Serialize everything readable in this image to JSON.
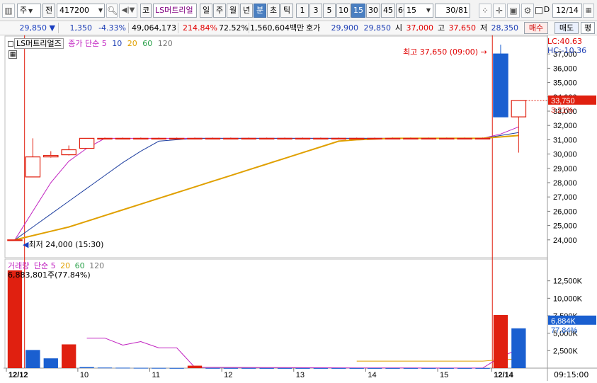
{
  "toolbar": {
    "market": "주",
    "prefix": "전",
    "code": "417200",
    "stock_badge": "코",
    "stock_name": "LS머트리얼",
    "periods": [
      "일",
      "주",
      "월",
      "년",
      "분",
      "초",
      "틱"
    ],
    "selected_period": "분",
    "intervals": [
      "1",
      "3",
      "5",
      "10",
      "15",
      "30",
      "45",
      "60"
    ],
    "selected_interval": "15",
    "interval_select": "15",
    "page_current": "30",
    "page_total": "/81",
    "d_label": "D",
    "date_input": "12/14"
  },
  "quote": {
    "price": "29,850",
    "direction": "▼",
    "change": "1,350",
    "change_pct": "-4.33%",
    "volume": "49,064,173",
    "volume_ratio": "214.84%",
    "turnover_ratio": "72.52%",
    "amount": "1,560,604백만",
    "hoga_label": "호가",
    "ask": "29,900",
    "bid": "29,850",
    "open_label": "시",
    "open": "37,000",
    "high_label": "고",
    "high": "37,650",
    "low_label": "저",
    "low": "28,350",
    "buy_button": "매수",
    "sell_button": "매도",
    "eval_button": "평"
  },
  "price_panel": {
    "stock_tag": "LS머트리얼즈",
    "ma_label": "종가 단순",
    "ma_periods": [
      "5",
      "10",
      "20",
      "60",
      "120"
    ],
    "lc": "LC:40.63",
    "hc": "HC:-10.36",
    "high_annot": "최고 37,650 (09:00)",
    "low_annot": "최저 24,000 (15:30)",
    "last_price": "33,750",
    "last_pct": "3.21%",
    "y_ticks": [
      "37,000",
      "36,000",
      "35,000",
      "34,000",
      "33,000",
      "32,000",
      "31,000",
      "30,000",
      "29,000",
      "28,000",
      "27,000",
      "26,000",
      "25,000",
      "24,000"
    ]
  },
  "volume_panel": {
    "label": "거래량",
    "ma_label": "단순",
    "ma_periods": [
      "5",
      "20",
      "60",
      "120"
    ],
    "value_text": "6,883,801주(77.84%)",
    "last_value": "6,884K",
    "last_pct": "77.84%",
    "y_ticks": [
      "12,500K",
      "10,000K",
      "7,500K",
      "5,000K",
      "2,500K"
    ]
  },
  "x_axis": {
    "labels": [
      "12/12",
      "10",
      "11",
      "12",
      "13",
      "14",
      "15",
      "12/14"
    ],
    "time": "09:15:00"
  },
  "colors": {
    "up": "#e02010",
    "down": "#1a5fd0",
    "ma5": "#c020c0",
    "ma10": "#1e3fa0",
    "ma20": "#e0a000",
    "ma60": "#28a048",
    "ma120": "#777777"
  },
  "chart_data": [
    {
      "type": "candlestick",
      "title": "LS머트리얼즈",
      "ylim": [
        23000,
        38000
      ],
      "candles": [
        {
          "o": 24000,
          "h": 24000,
          "l": 24000,
          "c": 24000
        },
        {
          "o": 28400,
          "h": 31100,
          "l": 28400,
          "c": 29800
        },
        {
          "o": 29800,
          "h": 30200,
          "l": 29750,
          "c": 29900
        },
        {
          "o": 29950,
          "h": 30600,
          "l": 29900,
          "c": 30300
        },
        {
          "o": 30400,
          "h": 31100,
          "l": 30400,
          "c": 31100
        },
        {
          "o": 31100,
          "h": 31150,
          "l": 31050,
          "c": 31100
        },
        {
          "o": 31100,
          "h": 31150,
          "l": 31050,
          "c": 31100
        },
        {
          "o": 31100,
          "h": 31150,
          "l": 31050,
          "c": 31100
        },
        {
          "o": 31100,
          "h": 31150,
          "l": 31050,
          "c": 31100
        },
        {
          "o": 31100,
          "h": 31150,
          "l": 31050,
          "c": 31100
        },
        {
          "o": 31100,
          "h": 31150,
          "l": 31050,
          "c": 31100
        },
        {
          "o": 31100,
          "h": 31150,
          "l": 31050,
          "c": 31100
        },
        {
          "o": 31100,
          "h": 31150,
          "l": 31050,
          "c": 31100
        },
        {
          "o": 31100,
          "h": 31150,
          "l": 31050,
          "c": 31100
        },
        {
          "o": 31100,
          "h": 31150,
          "l": 31050,
          "c": 31100
        },
        {
          "o": 31100,
          "h": 31150,
          "l": 31050,
          "c": 31100
        },
        {
          "o": 31100,
          "h": 31150,
          "l": 31050,
          "c": 31100
        },
        {
          "o": 31100,
          "h": 31150,
          "l": 31050,
          "c": 31100
        },
        {
          "o": 31100,
          "h": 31150,
          "l": 31050,
          "c": 31100
        },
        {
          "o": 31100,
          "h": 31150,
          "l": 31050,
          "c": 31100
        },
        {
          "o": 31100,
          "h": 31150,
          "l": 31050,
          "c": 31100
        },
        {
          "o": 31100,
          "h": 31150,
          "l": 31050,
          "c": 31100
        },
        {
          "o": 31100,
          "h": 31150,
          "l": 31050,
          "c": 31100
        },
        {
          "o": 31100,
          "h": 31150,
          "l": 31050,
          "c": 31100
        },
        {
          "o": 31100,
          "h": 31150,
          "l": 31050,
          "c": 31100
        },
        {
          "o": 31100,
          "h": 31150,
          "l": 31050,
          "c": 31100
        },
        {
          "o": 31100,
          "h": 31150,
          "l": 31050,
          "c": 31100
        },
        {
          "o": 37000,
          "h": 37650,
          "l": 32600,
          "c": 32600
        },
        {
          "o": 32600,
          "h": 33750,
          "l": 30100,
          "c": 33750
        }
      ],
      "ma": [
        {
          "name": "5",
          "values": [
            24000,
            26000,
            28000,
            29500,
            30400,
            31100,
            31100,
            31100,
            31100,
            31100,
            31100,
            31100,
            31100,
            31100,
            31100,
            31100,
            31100,
            31100,
            31100,
            31100,
            31100,
            31100,
            31100,
            31100,
            31100,
            31100,
            31100,
            31400,
            31900
          ]
        },
        {
          "name": "10",
          "values": [
            24000,
            24900,
            25800,
            26700,
            27600,
            28500,
            29400,
            30200,
            30900,
            31000,
            31100,
            31100,
            31100,
            31100,
            31100,
            31100,
            31100,
            31100,
            31100,
            31100,
            31100,
            31100,
            31100,
            31100,
            31100,
            31100,
            31100,
            31300,
            31500
          ]
        },
        {
          "name": "20",
          "values": [
            24000,
            24300,
            24600,
            24900,
            25300,
            25700,
            26100,
            26500,
            26900,
            27300,
            27700,
            28100,
            28500,
            28900,
            29300,
            29700,
            30100,
            30500,
            30900,
            31000,
            31050,
            31100,
            31100,
            31100,
            31100,
            31100,
            31100,
            31200,
            31300
          ]
        }
      ]
    },
    {
      "type": "bar",
      "title": "거래량",
      "ylim": [
        0,
        15000000
      ],
      "values": [
        14000000,
        2600000,
        1400000,
        3400000,
        150000,
        80000,
        60000,
        40000,
        30000,
        20000,
        350000,
        20000,
        15000,
        15000,
        10000,
        10000,
        10000,
        10000,
        10000,
        10000,
        10000,
        10000,
        10000,
        10000,
        10000,
        10000,
        10000,
        7600000,
        5700000
      ],
      "up": [
        true,
        false,
        false,
        true,
        false,
        false,
        false,
        false,
        false,
        false,
        true,
        false,
        false,
        false,
        false,
        false,
        false,
        false,
        false,
        false,
        false,
        false,
        false,
        false,
        false,
        false,
        false,
        true,
        false
      ],
      "ma5": [
        null,
        null,
        null,
        null,
        4300000,
        4300000,
        3300000,
        3800000,
        2900000,
        2900000,
        120000,
        120000,
        100000,
        90000,
        80000,
        70000,
        60000,
        50000,
        40000,
        30000,
        25000,
        20000,
        20000,
        15000,
        15000,
        10000,
        10000,
        1600000,
        2700000
      ],
      "ma20": [
        null,
        null,
        null,
        null,
        null,
        null,
        null,
        null,
        null,
        null,
        null,
        null,
        null,
        null,
        null,
        null,
        null,
        null,
        null,
        1000000,
        1000000,
        1000000,
        1000000,
        1000000,
        1000000,
        1000000,
        1000000,
        1200000,
        1300000
      ]
    }
  ]
}
